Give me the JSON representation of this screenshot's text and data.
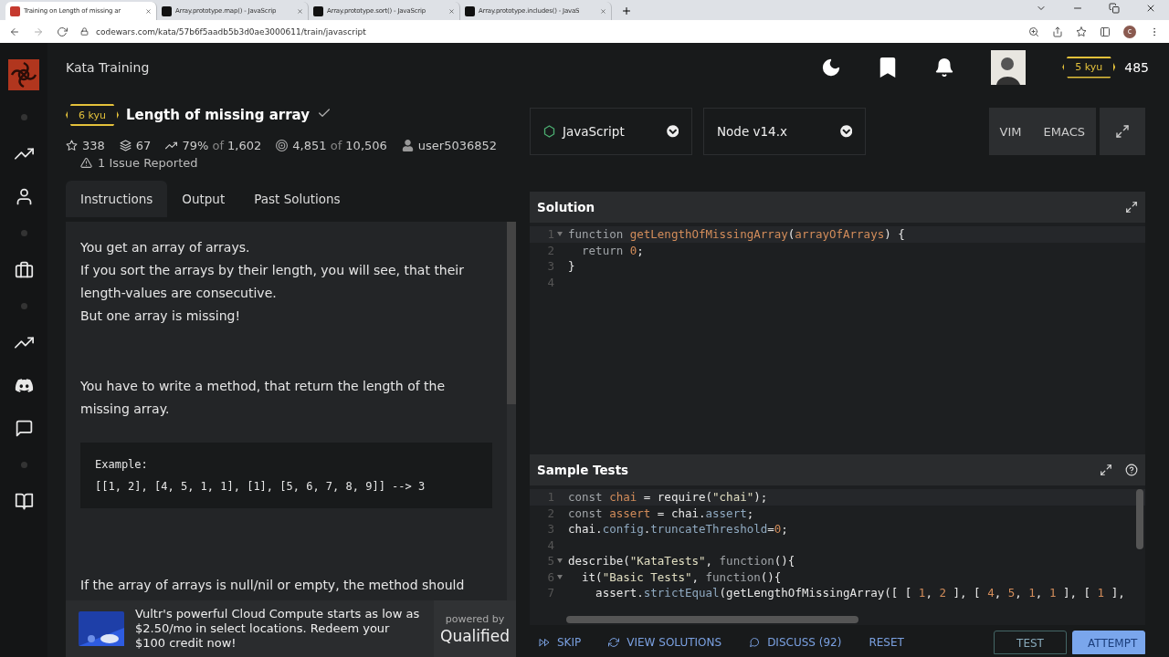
{
  "browser": {
    "tabs": [
      {
        "title": "Training on Length of missing ar",
        "kind": "codewars",
        "selected": true
      },
      {
        "title": "Array.prototype.map() - JavaScrip",
        "kind": "mdn",
        "selected": false
      },
      {
        "title": "Array.prototype.sort() - JavaScrip",
        "kind": "mdn",
        "selected": false
      },
      {
        "title": "Array.prototype.includes() - JavaS",
        "kind": "mdn",
        "selected": false
      }
    ],
    "url": "codewars.com/kata/57b6f5aadb5b3d0ae3000611/train/javascript",
    "profile_initial": "c"
  },
  "header": {
    "title": "Kata Training",
    "rank": "5 kyu",
    "honor": "485"
  },
  "kata": {
    "rank": "6 kyu",
    "title": "Length of missing array",
    "completed": true,
    "stats": [
      {
        "kind": "stars",
        "value": "338"
      },
      {
        "kind": "collections",
        "value": "67"
      },
      {
        "kind": "satisfaction",
        "value": "79%",
        "of": "of",
        "total": "1,602"
      },
      {
        "kind": "completions",
        "value": "4,851",
        "of": "of",
        "total": "10,506"
      },
      {
        "kind": "author",
        "value": "user5036852"
      }
    ],
    "issues": "1 Issue Reported"
  },
  "tabs": [
    {
      "label": "Instructions",
      "selected": true
    },
    {
      "label": "Output",
      "selected": false
    },
    {
      "label": "Past Solutions",
      "selected": false
    }
  ],
  "instructions": [
    {
      "kind": "text",
      "lines": [
        "You get an array of arrays.",
        "If you sort the arrays by their length, you will see, that their length-values are consecutive.",
        "But one array is missing!"
      ]
    },
    {
      "kind": "text",
      "lines": [
        "You have to write a method, that return the length of the missing array."
      ]
    },
    {
      "kind": "code",
      "lines": [
        "Example:",
        "[[1, 2], [4, 5, 1, 1], [1], [5, 6, 7, 8, 9]] --> 3"
      ]
    },
    {
      "kind": "text",
      "lines": [
        "If the array of arrays is null/nil or empty, the method should"
      ]
    }
  ],
  "ad": {
    "text": "Vultr's powerful Cloud Compute starts as low as $2.50/mo in select locations. Redeem your $100 credit now!",
    "powered": "powered by",
    "brand": "Qualified"
  },
  "language": "JavaScript",
  "runtime": "Node v14.x",
  "modes": [
    "VIM",
    "EMACS"
  ],
  "solution": {
    "title": "Solution",
    "lines": [
      {
        "n": "1",
        "fold": true,
        "tokens": [
          {
            "kind": "keyword",
            "t": "function "
          },
          {
            "kind": "def",
            "t": "getLengthOfMissingArray"
          },
          {
            "kind": "plain",
            "t": "("
          },
          {
            "kind": "def",
            "t": "arrayOfArrays"
          },
          {
            "kind": "plain",
            "t": ") {"
          }
        ]
      },
      {
        "n": "2",
        "fold": false,
        "tokens": [
          {
            "kind": "keyword",
            "t": "  return "
          },
          {
            "kind": "num",
            "t": "0"
          },
          {
            "kind": "plain",
            "t": ";"
          }
        ]
      },
      {
        "n": "3",
        "fold": false,
        "tokens": [
          {
            "kind": "plain",
            "t": "}"
          }
        ]
      },
      {
        "n": "4",
        "fold": false
      }
    ]
  },
  "tests": {
    "title": "Sample Tests",
    "lines": [
      {
        "n": "1",
        "fold": false,
        "tokens": [
          {
            "kind": "keyword",
            "t": "const "
          },
          {
            "kind": "def",
            "t": "chai"
          },
          {
            "kind": "plain",
            "t": " = require("
          },
          {
            "kind": "str",
            "t": "\"chai\""
          },
          {
            "kind": "plain",
            "t": ");"
          }
        ]
      },
      {
        "n": "2",
        "fold": false,
        "tokens": [
          {
            "kind": "keyword",
            "t": "const "
          },
          {
            "kind": "def",
            "t": "assert"
          },
          {
            "kind": "plain",
            "t": " = chai."
          },
          {
            "kind": "prop",
            "t": "assert"
          },
          {
            "kind": "plain",
            "t": ";"
          }
        ]
      },
      {
        "n": "3",
        "fold": false,
        "tokens": [
          {
            "kind": "plain",
            "t": "chai."
          },
          {
            "kind": "prop",
            "t": "config"
          },
          {
            "kind": "plain",
            "t": "."
          },
          {
            "kind": "prop",
            "t": "truncateThreshold"
          },
          {
            "kind": "plain",
            "t": "="
          },
          {
            "kind": "num",
            "t": "0"
          },
          {
            "kind": "plain",
            "t": ";"
          }
        ]
      },
      {
        "n": "4",
        "fold": false
      },
      {
        "n": "5",
        "fold": true,
        "tokens": [
          {
            "kind": "plain",
            "t": "describe("
          },
          {
            "kind": "str",
            "t": "\"KataTests\""
          },
          {
            "kind": "plain",
            "t": ", "
          },
          {
            "kind": "keyword",
            "t": "function"
          },
          {
            "kind": "plain",
            "t": "(){"
          }
        ]
      },
      {
        "n": "6",
        "fold": true,
        "tokens": [
          {
            "kind": "plain",
            "t": "  it("
          },
          {
            "kind": "str",
            "t": "\"Basic Tests\""
          },
          {
            "kind": "plain",
            "t": ", "
          },
          {
            "kind": "keyword",
            "t": "function"
          },
          {
            "kind": "plain",
            "t": "(){"
          }
        ]
      },
      {
        "n": "7",
        "fold": false,
        "tokens": [
          {
            "kind": "plain",
            "t": "    assert."
          },
          {
            "kind": "prop",
            "t": "strictEqual"
          },
          {
            "kind": "plain",
            "t": "(getLengthOfMissingArray([ [ "
          },
          {
            "kind": "num",
            "t": "1"
          },
          {
            "kind": "plain",
            "t": ", "
          },
          {
            "kind": "num",
            "t": "2"
          },
          {
            "kind": "plain",
            "t": " ], [ "
          },
          {
            "kind": "num",
            "t": "4"
          },
          {
            "kind": "plain",
            "t": ", "
          },
          {
            "kind": "num",
            "t": "5"
          },
          {
            "kind": "plain",
            "t": ", "
          },
          {
            "kind": "num",
            "t": "1"
          },
          {
            "kind": "plain",
            "t": ", "
          },
          {
            "kind": "num",
            "t": "1"
          },
          {
            "kind": "plain",
            "t": " ], [ "
          },
          {
            "kind": "num",
            "t": "1"
          },
          {
            "kind": "plain",
            "t": " ],"
          }
        ]
      }
    ]
  },
  "actions": [
    {
      "label": "SKIP",
      "kind": "skip"
    },
    {
      "label": "VIEW SOLUTIONS",
      "kind": "solutions"
    },
    {
      "label": "DISCUSS (92)",
      "kind": "discuss"
    },
    {
      "label": "RESET",
      "kind": "reset"
    }
  ],
  "run_buttons": [
    {
      "label": "TEST",
      "kind": "outline"
    },
    {
      "label": "ATTEMPT",
      "kind": "primary"
    }
  ]
}
